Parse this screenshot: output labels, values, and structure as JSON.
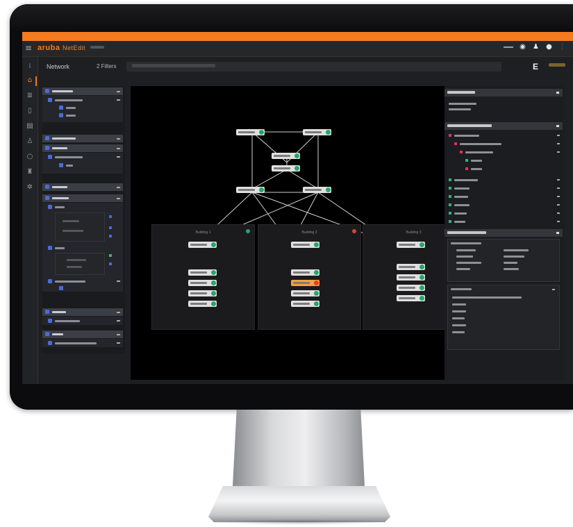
{
  "header": {
    "brand": "aruba",
    "product": "NetEdit",
    "right_icons": [
      "user-icon",
      "bell-icon",
      "info-icon"
    ]
  },
  "breadcrumb": {
    "title": "Network",
    "filter": "2 Filters",
    "action": "E"
  },
  "canvas": {
    "zones": [
      {
        "name": "Building 1",
        "status": "ok"
      },
      {
        "name": "Building 2",
        "status": "error"
      },
      {
        "name": "Building 3",
        "status": "ok"
      }
    ]
  },
  "colors": {
    "accent": "#f47b20",
    "status_ok": "#22a86a",
    "status_error": "#e0402e",
    "highlight_switch": "#f3a23c",
    "section_icon": "#4a6bd6",
    "health_error": "#e2325c",
    "health_ok": "#2fb37a"
  },
  "icons": {
    "left_rail": [
      "hierarchy-icon",
      "network-topology-icon",
      "stack-icon",
      "device-icon",
      "document-icon",
      "people-icon",
      "search-icon",
      "lock-icon",
      "gear-icon"
    ]
  }
}
